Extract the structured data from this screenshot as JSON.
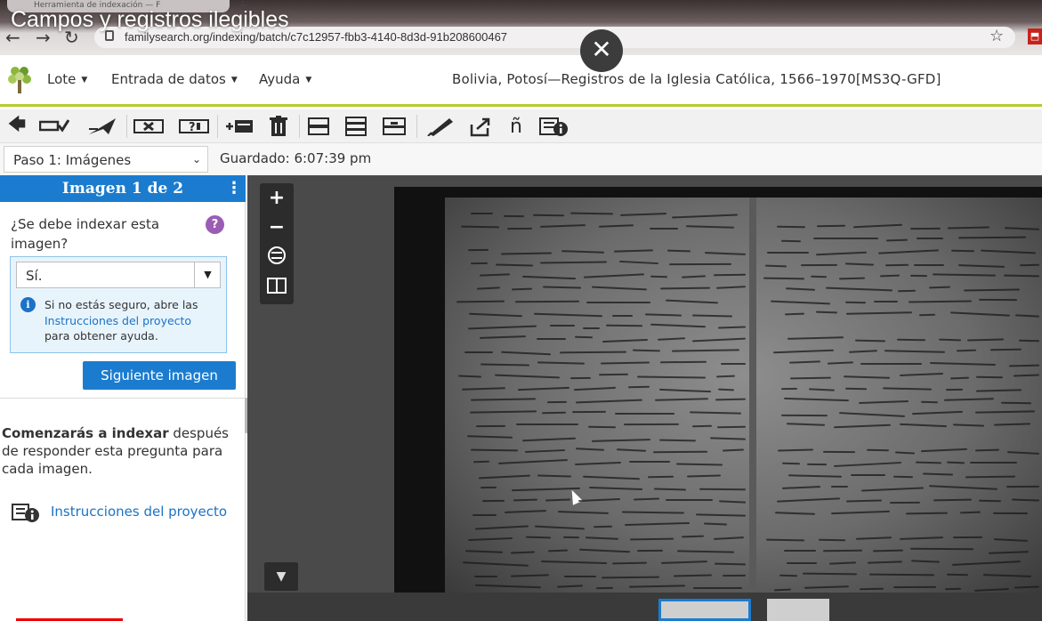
{
  "video": {
    "title": "Campos y registros ilegibles"
  },
  "browser": {
    "tab_label": "Herramienta de indexación — F",
    "url": "familysearch.org/indexing/batch/c7c12957-fbb3-4140-8d3d-91b208600467"
  },
  "header": {
    "menus": [
      "Lote",
      "Entrada de datos",
      "Ayuda"
    ],
    "project_title": "Bolivia, Potosí—Registros de la Iglesia Católica, 1566–1970[MS3Q-GFD]"
  },
  "subbar": {
    "step": "Paso 1: Imágenes",
    "saved": "Guardado: 6:07:39 pm"
  },
  "panel": {
    "heading": "Imagen 1 de 2",
    "question": "¿Se debe indexar esta imagen?",
    "answer": "Sí.",
    "info_prefix": "Si no estás seguro, abre las",
    "info_link": "Instrucciones del proyecto",
    "info_suffix": "para obtener ayuda.",
    "next_button": "Siguiente imagen",
    "begin_bold": "Comenzarás a indexar",
    "begin_rest": " después de responder esta pregunta para cada imagen.",
    "instructions_link": "Instrucciones del proyecto"
  },
  "colors": {
    "accent_blue": "#1b7ccf",
    "header_rule": "#b5cc2e",
    "help_purple": "#9b5db4"
  }
}
